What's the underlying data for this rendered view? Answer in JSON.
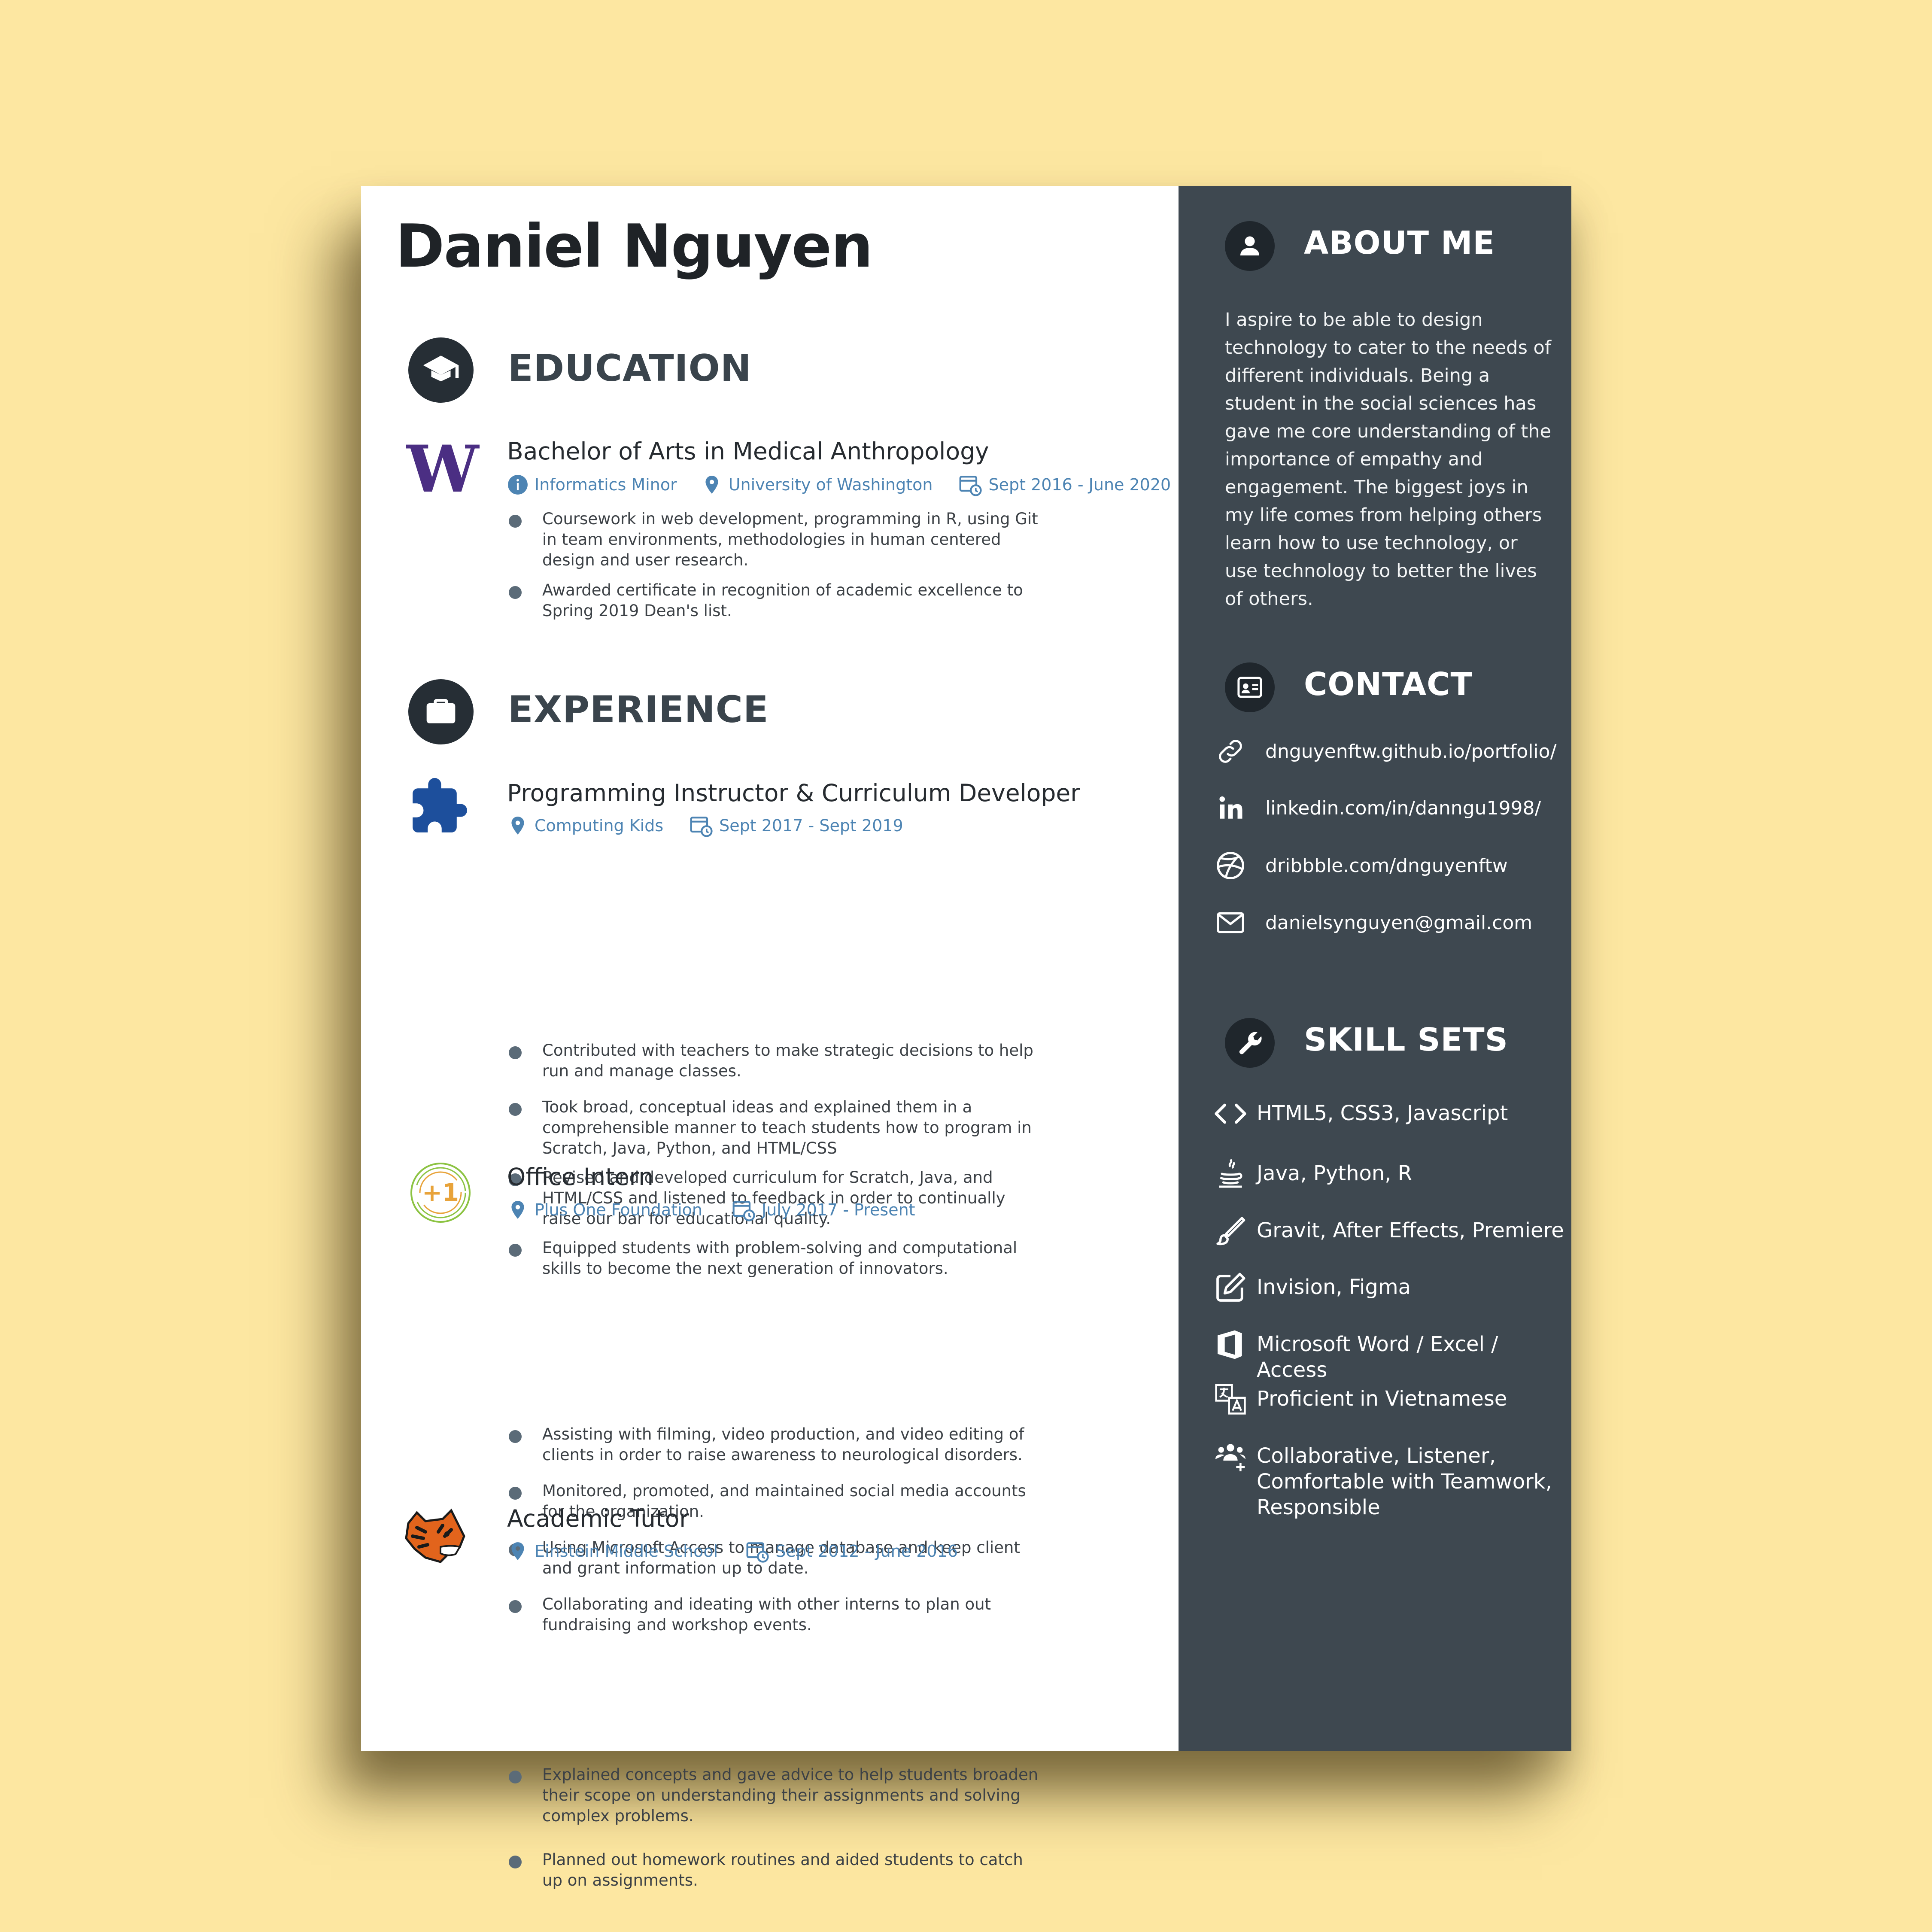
{
  "name": "Daniel Nguyen",
  "education": {
    "title": "EDUCATION",
    "entries": [
      {
        "logo_letter": "W",
        "title": "Bachelor of Arts in Medical Anthropology",
        "minor": "Informatics Minor",
        "location": "University of Washington",
        "dates": "Sept 2016 - June 2020",
        "bullets": [
          "Coursework in web development, programming in R, using Git in team environments, methodologies in human centered design and user research.",
          "Awarded certificate in recognition of academic excellence to Spring 2019 Dean's list."
        ]
      }
    ]
  },
  "experience": {
    "title": "EXPERIENCE",
    "entries": [
      {
        "title": "Programming Instructor & Curriculum Developer",
        "location": "Computing Kids",
        "dates": "Sept 2017 - Sept 2019",
        "bullets": [
          "Contributed with teachers to make strategic decisions to help run and manage classes.",
          "Took broad, conceptual ideas and explained them in a comprehensible manner to teach students how to program in Scratch, Java, Python, and HTML/CSS",
          "Revised and developed curriculum for Scratch, Java, and HTML/CSS and listened to feedback in order to continually raise our bar for educational quality.",
          "Equipped students with problem-solving and computational skills to become the next generation of innovators."
        ]
      },
      {
        "logo_text": "+1",
        "title": "Office Intern",
        "location": "Plus One Foundation",
        "dates": "July 2017 - Present",
        "bullets": [
          "Assisting with filming, video production, and video editing of clients in order to raise awareness to neurological disorders.",
          "Monitored, promoted, and maintained social media accounts for the organization.",
          "Using Microsoft Access to manage database and keep client and grant information up to date.",
          "Collaborating and ideating with other interns to plan out fundraising and workshop events."
        ]
      },
      {
        "title": "Academic Tutor",
        "location": "Einstein Middle School",
        "dates": "Sept 2012 - June 2016",
        "bullets": [
          "Explained concepts and gave advice to help students broaden their scope on understanding their assignments and solving complex problems.",
          "Planned out homework routines and aided students to catch up on assignments."
        ]
      }
    ]
  },
  "about": {
    "title": "ABOUT ME",
    "text": "I aspire to be able to design technology to cater to the needs of different individuals. Being a student in the social sciences has gave me core understanding of the importance of empathy and engagement. The biggest joys in my life comes from helping others learn how to use technology, or use technology to better the lives of others."
  },
  "contact": {
    "title": "CONTACT",
    "items": [
      {
        "icon": "link-icon",
        "text": "dnguyenftw.github.io/portfolio/"
      },
      {
        "icon": "linkedin-icon",
        "text": "linkedin.com/in/danngu1998/"
      },
      {
        "icon": "dribbble-icon",
        "text": "dribbble.com/dnguyenftw"
      },
      {
        "icon": "envelope-icon",
        "text": "danielsynguyen@gmail.com"
      }
    ]
  },
  "skills": {
    "title": "SKILL SETS",
    "items": [
      {
        "icon": "code-icon",
        "text": "HTML5, CSS3, Javascript"
      },
      {
        "icon": "java-icon",
        "text": "Java, Python, R"
      },
      {
        "icon": "brush-icon",
        "text": "Gravit, After Effects, Premiere"
      },
      {
        "icon": "edit-icon",
        "text": "Invision, Figma"
      },
      {
        "icon": "office-icon",
        "text": "Microsoft Word / Excel / Access"
      },
      {
        "icon": "translate-icon",
        "text": "Proficient in Vietnamese"
      },
      {
        "icon": "team-icon",
        "text": "Collaborative, Listener, Comfortable with Teamwork, Responsible"
      }
    ]
  },
  "colors": {
    "background": "#fde7a1",
    "sidebar": "#3e4850",
    "accent": "#4d84b3",
    "uw_purple": "#4b2e83"
  }
}
